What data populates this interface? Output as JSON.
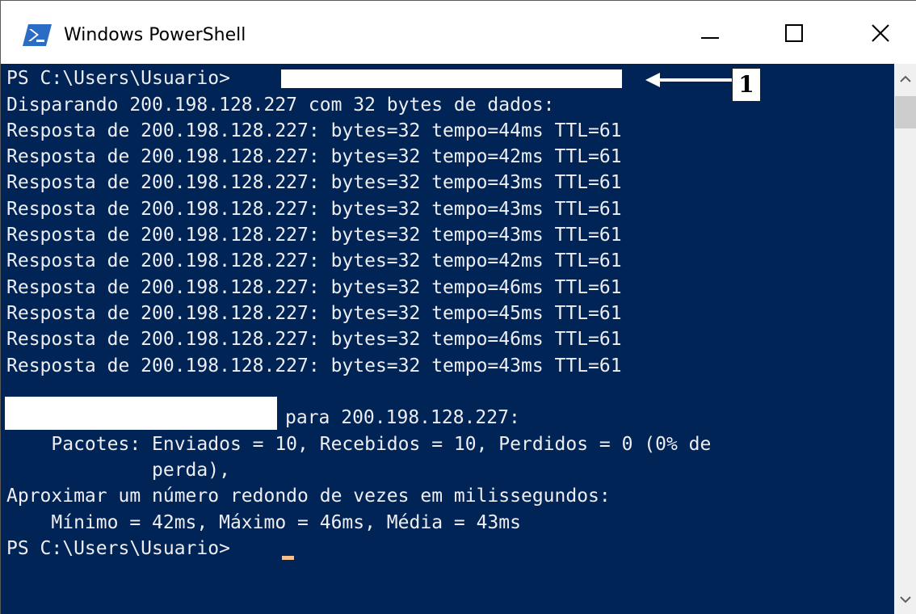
{
  "window": {
    "title": "Windows PowerShell",
    "controls": {
      "minimize": "minimize",
      "maximize": "maximize",
      "close": "close"
    }
  },
  "console": {
    "prompt_line": "PS C:\\Users\\Usuario> ",
    "ping_header": "Disparando 200.198.128.227 com 32 bytes de dados:",
    "replies": [
      "Resposta de 200.198.128.227: bytes=32 tempo=44ms TTL=61",
      "Resposta de 200.198.128.227: bytes=32 tempo=42ms TTL=61",
      "Resposta de 200.198.128.227: bytes=32 tempo=43ms TTL=61",
      "Resposta de 200.198.128.227: bytes=32 tempo=43ms TTL=61",
      "Resposta de 200.198.128.227: bytes=32 tempo=43ms TTL=61",
      "Resposta de 200.198.128.227: bytes=32 tempo=42ms TTL=61",
      "Resposta de 200.198.128.227: bytes=32 tempo=46ms TTL=61",
      "Resposta de 200.198.128.227: bytes=32 tempo=45ms TTL=61",
      "Resposta de 200.198.128.227: bytes=32 tempo=46ms TTL=61",
      "Resposta de 200.198.128.227: bytes=32 tempo=43ms TTL=61"
    ],
    "stats_header_suffix": "para 200.198.128.227:",
    "packets_line": "    Pacotes: Enviados = 10, Recebidos = 10, Perdidos = 0 (0% de",
    "packets_line_cont": "             perda),",
    "rtt_header": "Aproximar um número redondo de vezes em milissegundos:",
    "rtt_values": "    Mínimo = 42ms, Máximo = 46ms, Média = 43ms",
    "final_prompt": "PS C:\\Users\\Usuario> "
  },
  "annotation": {
    "label": "1"
  },
  "colors": {
    "console_bg": "#012456",
    "console_text": "#eeedf0",
    "cursor": "#f5c089",
    "titlebar_bg": "#ffffff"
  },
  "icons": {
    "app": "powershell-icon",
    "minimize": "minimize-icon",
    "maximize": "maximize-icon",
    "close": "close-icon",
    "scroll_up": "chevron-up-icon",
    "scroll_down": "chevron-down-icon"
  }
}
